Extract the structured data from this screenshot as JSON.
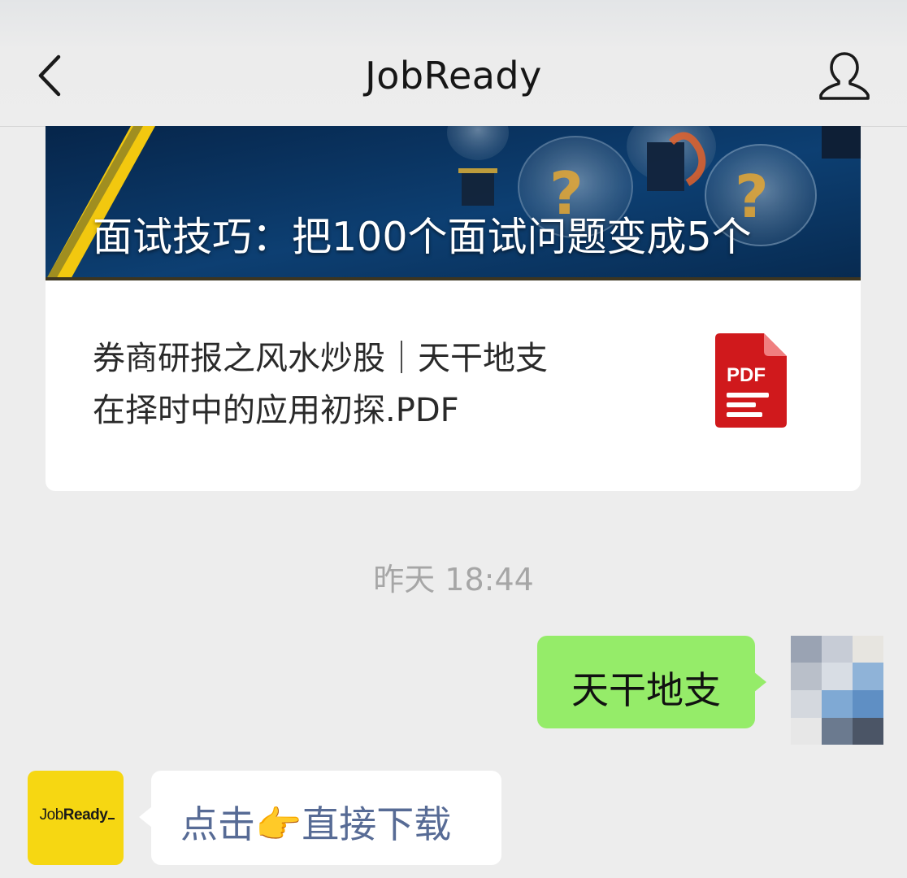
{
  "app": {
    "title": "JobReady"
  },
  "nav": {
    "back_icon": "chevron-left-icon",
    "profile_icon": "person-outline-icon"
  },
  "article": {
    "banner_title": "面试技巧：把100个面试问题变成5个",
    "doc_title_line1": "券商研报之风水炒股｜天干地支",
    "doc_title_line2": "在择时中的应用初探.PDF",
    "file_icon": "pdf-file-icon",
    "file_icon_label": "PDF",
    "file_icon_color": "#d0191c"
  },
  "chat": {
    "timestamp": "昨天 18:44",
    "sent_message": "天干地支",
    "received_message": "点击👉直接下载",
    "sent_bubble_color": "#95ec69",
    "link_color": "#576b95"
  },
  "brand_avatar": {
    "text_thin": "Job",
    "text_bold": "Ready",
    "background": "#f6d712"
  }
}
